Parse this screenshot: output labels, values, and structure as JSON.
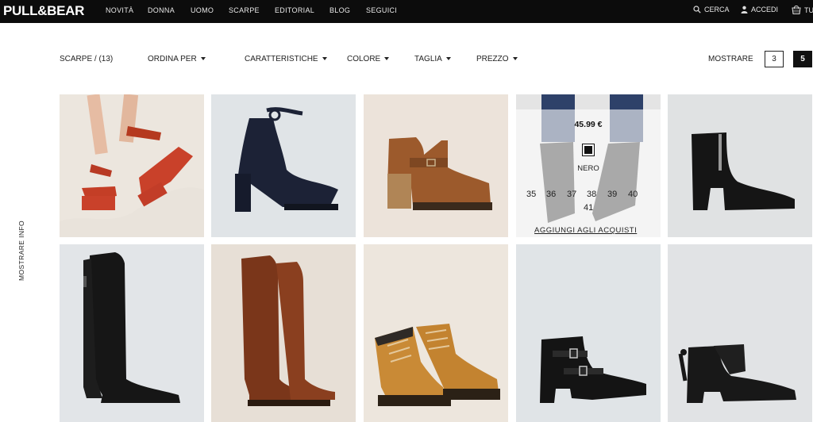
{
  "brand": "PULL&BEAR",
  "nav": {
    "items": [
      "NOVITÀ",
      "DONNA",
      "UOMO",
      "SCARPE",
      "EDITORIAL",
      "BLOG",
      "SEGUICI"
    ],
    "search": "CERCA",
    "login": "ACCEDI",
    "cart": "TU"
  },
  "filters": {
    "category": "SCARPE / (13)",
    "sort": "ORDINA PER",
    "features": "CARATTERISTICHE",
    "color": "COLORE",
    "size": "TAGLIA",
    "price": "PREZZO"
  },
  "view": {
    "label": "MOSTRARE",
    "options": [
      "3",
      "5"
    ],
    "selected": "5"
  },
  "side_label": "MOSTRARE INFO",
  "hover_product": {
    "price": "45.99 €",
    "color_name": "NERO",
    "swatch_color": "#111111",
    "sizes": [
      "35",
      "36",
      "37",
      "38",
      "39",
      "40",
      "41"
    ],
    "add_to_cart": "AGGIUNGI AGLI ACQUISTI"
  },
  "products": [
    {
      "name": "red-platform-sandal",
      "color": "#c9412a"
    },
    {
      "name": "navy-ankle-strap-heel",
      "color": "#1c2236"
    },
    {
      "name": "tan-cutout-bootie",
      "color": "#9c5a2c"
    },
    {
      "name": "black-fringe-boot",
      "color": "#2a2a2a"
    },
    {
      "name": "black-zip-ankle-boot",
      "color": "#151515"
    },
    {
      "name": "black-knee-boot",
      "color": "#161616"
    },
    {
      "name": "brown-knee-boot",
      "color": "#7a361a"
    },
    {
      "name": "tan-work-boot",
      "color": "#c98a36"
    },
    {
      "name": "black-buckle-boot",
      "color": "#141414"
    },
    {
      "name": "black-tassel-bootie",
      "color": "#181818"
    }
  ]
}
